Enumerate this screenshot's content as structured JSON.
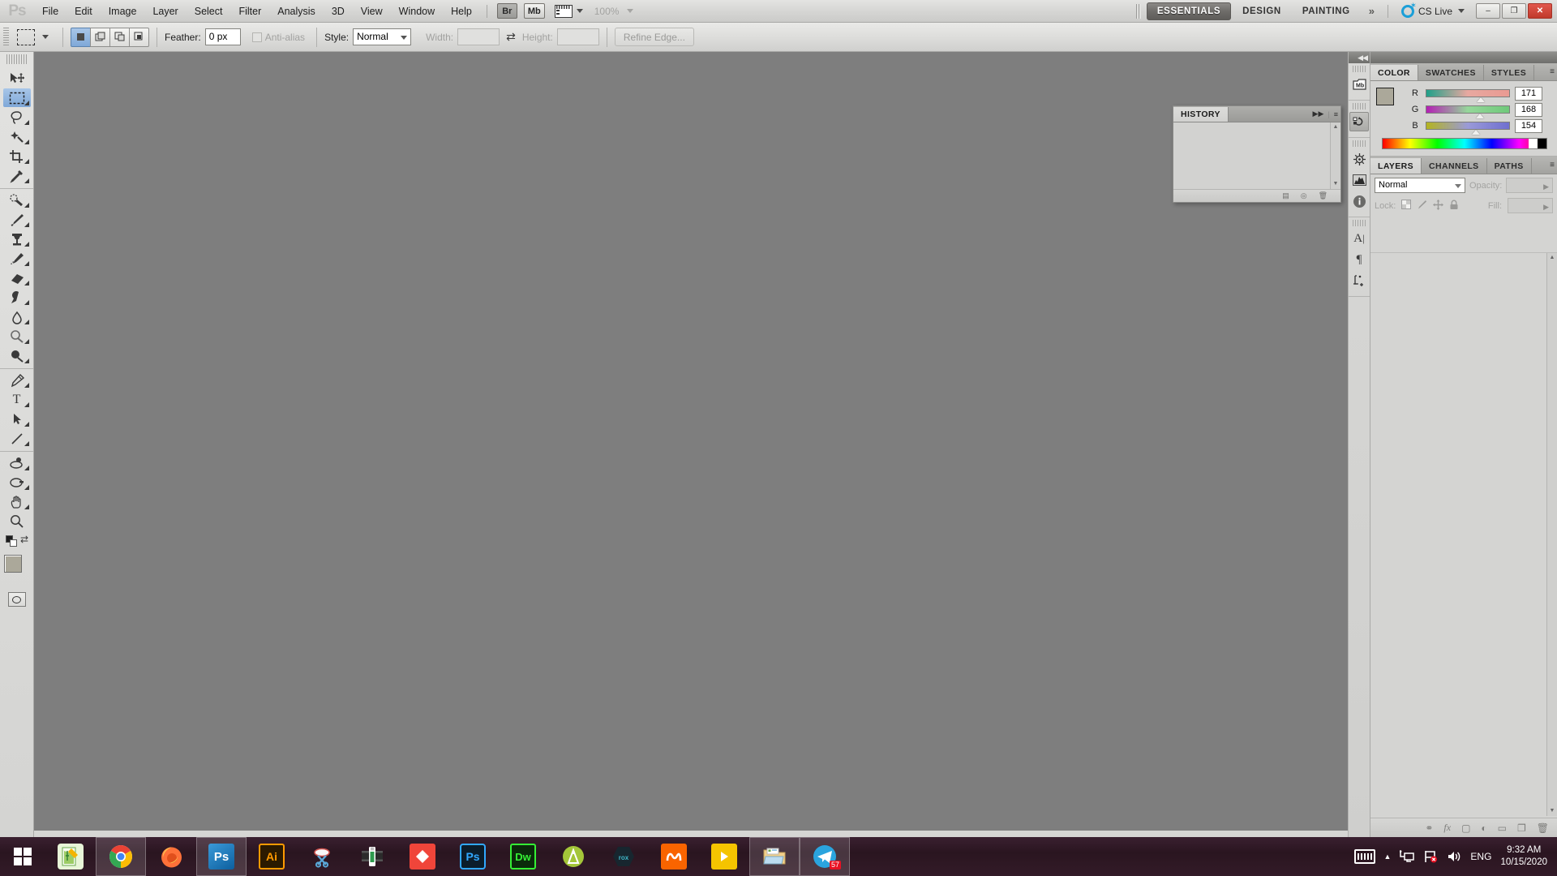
{
  "app": {
    "name": "Adobe Photoshop CS5",
    "logo_text": "Ps"
  },
  "menubar": {
    "items": [
      {
        "label": "File"
      },
      {
        "label": "Edit"
      },
      {
        "label": "Image"
      },
      {
        "label": "Layer"
      },
      {
        "label": "Select"
      },
      {
        "label": "Filter"
      },
      {
        "label": "Analysis"
      },
      {
        "label": "3D"
      },
      {
        "label": "View"
      },
      {
        "label": "Window"
      },
      {
        "label": "Help"
      }
    ],
    "bridge_label": "Br",
    "minibridge_label": "Mb",
    "zoom_level": "100%",
    "workspaces": [
      {
        "label": "ESSENTIALS",
        "active": true
      },
      {
        "label": "DESIGN",
        "active": false
      },
      {
        "label": "PAINTING",
        "active": false
      }
    ],
    "more_workspaces": "»",
    "cs_live_label": "CS Live",
    "window_buttons": {
      "minimize": "–",
      "restore": "❐",
      "close": "✕"
    }
  },
  "options_bar": {
    "tool_icon": "rectangular-marquee",
    "selection_modes": [
      "new-selection",
      "add-to-selection",
      "subtract-from-selection",
      "intersect-with-selection"
    ],
    "feather_label": "Feather:",
    "feather_value": "0 px",
    "antialias_label": "Anti-alias",
    "antialias_checked": false,
    "style_label": "Style:",
    "style_value": "Normal",
    "width_label": "Width:",
    "width_value": "",
    "height_label": "Height:",
    "height_value": "",
    "refine_edge_label": "Refine Edge..."
  },
  "toolbox": {
    "groups": [
      {
        "tools": [
          {
            "name": "move-tool",
            "glyph": "✥",
            "selected": false,
            "has_flyout": false
          },
          {
            "name": "rectangular-marquee-tool",
            "glyph": "⬚",
            "selected": true,
            "has_flyout": true
          },
          {
            "name": "lasso-tool",
            "glyph": "○",
            "selected": false,
            "has_flyout": true
          },
          {
            "name": "quick-selection-tool",
            "glyph": "✳",
            "selected": false,
            "has_flyout": true
          },
          {
            "name": "crop-tool",
            "glyph": "⌗",
            "selected": false,
            "has_flyout": true
          },
          {
            "name": "eyedropper-tool",
            "glyph": "✎",
            "selected": false,
            "has_flyout": true
          }
        ]
      },
      {
        "tools": [
          {
            "name": "spot-healing-brush-tool",
            "glyph": "◑",
            "selected": false,
            "has_flyout": true
          },
          {
            "name": "brush-tool",
            "glyph": "✐",
            "selected": false,
            "has_flyout": true
          },
          {
            "name": "clone-stamp-tool",
            "glyph": "⑂",
            "selected": false,
            "has_flyout": true
          },
          {
            "name": "history-brush-tool",
            "glyph": "✏",
            "selected": false,
            "has_flyout": true
          },
          {
            "name": "eraser-tool",
            "glyph": "▱",
            "selected": false,
            "has_flyout": true
          },
          {
            "name": "gradient-tool",
            "glyph": "◩",
            "selected": false,
            "has_flyout": true
          },
          {
            "name": "blur-tool",
            "glyph": "●",
            "selected": false,
            "has_flyout": true
          },
          {
            "name": "dodge-tool",
            "glyph": "⚬",
            "selected": false,
            "has_flyout": true
          },
          {
            "name": "burn-tool",
            "glyph": "●",
            "selected": false,
            "has_flyout": true
          }
        ]
      },
      {
        "tools": [
          {
            "name": "pen-tool",
            "glyph": "✒",
            "selected": false,
            "has_flyout": true
          },
          {
            "name": "horizontal-type-tool",
            "glyph": "T",
            "selected": false,
            "has_flyout": true
          },
          {
            "name": "path-selection-tool",
            "glyph": "➤",
            "selected": false,
            "has_flyout": true
          },
          {
            "name": "line-tool",
            "glyph": "╱",
            "selected": false,
            "has_flyout": true
          }
        ]
      },
      {
        "tools": [
          {
            "name": "3d-rotate-tool",
            "glyph": "❂",
            "selected": false,
            "has_flyout": true
          },
          {
            "name": "3d-orbit-tool",
            "glyph": "↺",
            "selected": false,
            "has_flyout": true
          },
          {
            "name": "hand-tool",
            "glyph": "✋",
            "selected": false,
            "has_flyout": true
          },
          {
            "name": "zoom-tool",
            "glyph": "⚲",
            "selected": false,
            "has_flyout": false
          }
        ]
      }
    ],
    "foreground_color": "#aba89a",
    "background_color": "#ffffff",
    "quick_mask_label": "edit-in-quick-mask-mode"
  },
  "icon_dock": {
    "collapse_glyph": "◀◀",
    "groups": [
      {
        "buttons": [
          {
            "name": "mini-bridge-icon",
            "label": "Mb"
          }
        ]
      },
      {
        "buttons": [
          {
            "name": "history-icon",
            "label": "↶"
          }
        ]
      },
      {
        "buttons": [
          {
            "name": "adjustments-icon",
            "label": "☸"
          },
          {
            "name": "histogram-icon",
            "label": "◤"
          },
          {
            "name": "info-icon",
            "label": "ℹ"
          }
        ]
      },
      {
        "buttons": [
          {
            "name": "character-icon",
            "label": "A"
          },
          {
            "name": "paragraph-icon",
            "label": "¶"
          },
          {
            "name": "notes-icon",
            "label": "↗"
          }
        ]
      }
    ]
  },
  "color_panel": {
    "tabs": [
      {
        "label": "COLOR",
        "active": true
      },
      {
        "label": "SWATCHES",
        "active": false
      },
      {
        "label": "STYLES",
        "active": false
      }
    ],
    "menu_glyph": "≡",
    "channels": [
      {
        "label": "R",
        "value": "171",
        "thumb_pct": 67
      },
      {
        "label": "G",
        "value": "168",
        "thumb_pct": 66
      },
      {
        "label": "B",
        "value": "154",
        "thumb_pct": 60
      }
    ],
    "foreground_color": "#aba89a",
    "background_color": "#ffffff"
  },
  "layers_panel": {
    "tabs": [
      {
        "label": "LAYERS",
        "active": true
      },
      {
        "label": "CHANNELS",
        "active": false
      },
      {
        "label": "PATHS",
        "active": false
      }
    ],
    "menu_glyph": "≡",
    "blend_mode": "Normal",
    "opacity_label": "Opacity:",
    "opacity_value": "",
    "lock_label": "Lock:",
    "lock_icons": [
      "lock-transparent-pixels",
      "lock-image-pixels",
      "lock-position",
      "lock-all"
    ],
    "fill_label": "Fill:",
    "fill_value": "",
    "footer_buttons": [
      {
        "name": "link-layers-icon",
        "glyph": "⚭"
      },
      {
        "name": "layer-style-icon",
        "glyph": "fx"
      },
      {
        "name": "layer-mask-icon",
        "glyph": "▢"
      },
      {
        "name": "adjustment-layer-icon",
        "glyph": "◐"
      },
      {
        "name": "new-group-icon",
        "glyph": "▭"
      },
      {
        "name": "new-layer-icon",
        "glyph": "❐"
      },
      {
        "name": "delete-layer-icon",
        "glyph": "🗑"
      }
    ]
  },
  "history_panel": {
    "tabs": [
      {
        "label": "HISTORY",
        "active": true
      }
    ],
    "expand_glyph": "▶▶",
    "menu_glyph": "≡",
    "entries": [],
    "footer_buttons": [
      {
        "name": "new-document-from-state-icon",
        "glyph": "▤"
      },
      {
        "name": "new-snapshot-icon",
        "glyph": "◎"
      },
      {
        "name": "delete-state-icon",
        "glyph": "🗑"
      }
    ]
  },
  "taskbar": {
    "start_label": "start-button",
    "items": [
      {
        "name": "notepadpp-task",
        "label": "N",
        "running": false,
        "bg": "#8ac24a",
        "fg": "#ffffff"
      },
      {
        "name": "chrome-task",
        "label": "",
        "running": true,
        "bg": "#ffffff",
        "fg": "#4285f4"
      },
      {
        "name": "firefox-task",
        "label": "",
        "running": false,
        "bg": "#ff9500",
        "fg": "#ffffff"
      },
      {
        "name": "photoshop-task",
        "label": "Ps",
        "running": true,
        "bg": "#1c6fb8",
        "fg": "#8fd3ff"
      },
      {
        "name": "illustrator-task",
        "label": "Ai",
        "running": false,
        "bg": "#2b1a00",
        "fg": "#ff9a00"
      },
      {
        "name": "snipping-tool-task",
        "label": "",
        "running": false,
        "bg": "#f2f2f2",
        "fg": "#49a0d8"
      },
      {
        "name": "camtasia-task",
        "label": "",
        "running": false,
        "bg": "#2e7d32",
        "fg": "#ffffff"
      },
      {
        "name": "premiere-task",
        "label": "",
        "running": false,
        "bg": "#f0453a",
        "fg": "#ffffff"
      },
      {
        "name": "photoshop-2-task",
        "label": "Ps",
        "running": false,
        "bg": "#0b1d2b",
        "fg": "#31a8ff"
      },
      {
        "name": "dreamweaver-task",
        "label": "Dw",
        "running": false,
        "bg": "#0b2b0b",
        "fg": "#35f035"
      },
      {
        "name": "android-studio-task",
        "label": "",
        "running": false,
        "bg": "#a4c639",
        "fg": "#ffffff"
      },
      {
        "name": "rox-task",
        "label": "rox",
        "running": false,
        "bg": "#1b2a33",
        "fg": "#3fb6c8"
      },
      {
        "name": "xampp-task",
        "label": "",
        "running": false,
        "bg": "#f96400",
        "fg": "#ffffff"
      },
      {
        "name": "media-player-task",
        "label": "▶",
        "running": false,
        "bg": "#f5c400",
        "fg": "#ffffff"
      },
      {
        "name": "file-explorer-task",
        "label": "",
        "running": true,
        "bg": "#f5d58a",
        "fg": "#2f6fa8"
      },
      {
        "name": "telegram-task",
        "label": "",
        "running": true,
        "bg": "#2aa4de",
        "fg": "#ffffff",
        "badge": "57"
      }
    ],
    "tray": {
      "keyboard_icon": "touch-keyboard-icon",
      "show_hidden_icons": "▲",
      "network_icon": "network-icon",
      "flag_icon": "action-center-icon",
      "volume_icon": "🔊",
      "language": "ENG",
      "time": "9:32 AM",
      "date": "10/15/2020"
    }
  }
}
